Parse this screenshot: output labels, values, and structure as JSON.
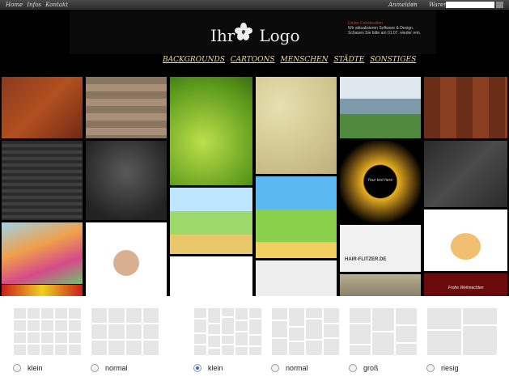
{
  "topbar": {
    "nav": [
      "Home",
      "Infos",
      "Kontakt"
    ],
    "login": "Anmelden",
    "cart": "Warenkorb"
  },
  "logo": {
    "word1": "Ihr",
    "word2": "Logo"
  },
  "under_construction": {
    "title": "Under Construction",
    "line1": "Wir aktualisieren Software & Design.",
    "line2": "Schauen Sie bitte am 01.07. wieder rein."
  },
  "categories": [
    "BACKGROUNDS",
    "CARTOONS",
    "MENSCHEN",
    "STÄDTE",
    "SONSTIGES"
  ],
  "gallery_text": {
    "circle_text": "Your text here",
    "banner_text": "HAIR-FLITZER.DE",
    "xmas_text": "Frohe Weihnachten"
  },
  "layout_options": {
    "group_a": [
      {
        "label": "klein",
        "selected": false
      },
      {
        "label": "normal",
        "selected": false
      }
    ],
    "group_b": [
      {
        "label": "klein",
        "selected": true
      },
      {
        "label": "normal",
        "selected": false
      },
      {
        "label": "groß",
        "selected": false
      },
      {
        "label": "riesig",
        "selected": false
      }
    ]
  },
  "colors": {
    "accent": "#f3e18c",
    "alert": "#dd3333",
    "radio_selected": "#2a6fd4"
  }
}
